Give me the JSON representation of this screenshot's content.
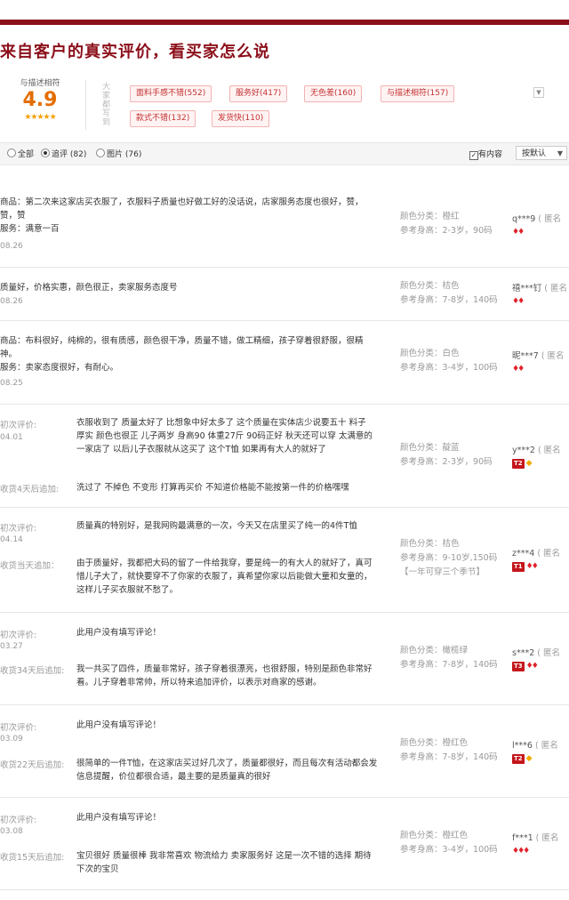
{
  "heading": "来自客户的真实评价，看买家怎么说",
  "score": {
    "label": "与描述相符",
    "value": "4.9",
    "stars": "★★★★★"
  },
  "tags_title": "大家都写到",
  "tags": [
    "面料手感不错(552)",
    "服务好(417)",
    "无色差(160)",
    "与描述相符(157)",
    "款式不错(132)",
    "发货快(110)"
  ],
  "filter": {
    "all": "全部",
    "append": "追评 (82)",
    "photo": "图片 (76)",
    "has_content": "有内容",
    "sort": "按默认"
  },
  "labels": {
    "color": "颜色分类：",
    "height": "参考身高：",
    "first": "初次评价:",
    "anon": "( 匿名"
  },
  "reviews": [
    {
      "text": "商品：第二次来这家店买衣服了，衣服料子质量也好做工好的没话说，店家服务态度也很好，赞，赞，赞\n服务：满意一百",
      "date": "08.26",
      "color": "橙红",
      "height": "2-3岁，90码",
      "user": "q***9",
      "badge": "hearts2"
    },
    {
      "text": "质量好，价格实惠，颜色很正，卖家服务态度号",
      "date": "08.26",
      "color": "桔色",
      "height": "7-8岁，140码",
      "user": "禧***钉",
      "badge": "hearts2"
    },
    {
      "text": "商品：布料很好，纯棉的，很有质感，颜色很干净，质量不错，做工精细，孩子穿着很舒服，很精神。\n服务：卖家态度很好，有耐心。",
      "date": "08.25",
      "color": "白色",
      "height": "3-4岁，100码",
      "user": "昵***7",
      "badge": "hearts2"
    },
    {
      "first_text": "衣服收到了 质量太好了 比想象中好太多了 这个质量在实体店少说要五十 料子厚实 颜色也很正 儿子两岁 身高90 体重27斤 90码正好 秋天还可以穿 太满意的一家店了 以后儿子衣服就从这买了 这个T恤 如果再有大人的就好了",
      "date": "04.01",
      "append_label": "收货4天后追加:",
      "append_text": "洗过了 不掉色 不变形 打算再买价 不知道价格能不能按第一件的价格嘿嘿",
      "color": "靛蓝",
      "height": "2-3岁，90码",
      "user": "y***2",
      "badge": "T2"
    },
    {
      "first_text": "质量真的特别好，是我网购最满意的一次，今天又在店里买了纯一的4件T恤",
      "date": "04.14",
      "append_label": "收货当天追加：",
      "append_text": "由于质量好，我都把大码的留了一件给我穿，要是纯一的有大人的就好了，真可惜儿子大了，就快要穿不了你家的衣服了，真希望你家以后能做大童和女童的，这样儿子买衣服就不愁了。",
      "color": "桔色",
      "height": "9-10岁,150码",
      "height_note": "【一年可穿三个季节】",
      "user": "z***4",
      "badge": "T1"
    },
    {
      "first_text": "此用户没有填写评论！",
      "date": "03.27",
      "append_label": "收货34天后追加:",
      "append_text": "我一共买了四件，质量非常好，孩子穿着很漂亮，也很舒服，特别是颜色非常好看。儿子穿着非常帅，所以特来追加评价，以表示对商家的感谢。",
      "color": "橄榄绿",
      "height": "7-8岁，140码",
      "user": "s***2",
      "badge": "T3"
    },
    {
      "first_text": "此用户没有填写评论！",
      "date": "03.09",
      "append_label": "收货22天后追加:",
      "append_text": "很简单的一件T恤，在这家店买过好几次了，质量都很好，而且每次有活动都会发信息提醒，价位都很合适，最主要的是质量真的很好",
      "color": "橙红色",
      "height": "7-8岁，140码",
      "user": "l***6",
      "badge": "T2"
    },
    {
      "first_text": "此用户没有填写评论！",
      "date": "03.08",
      "append_label": "收货15天后追加:",
      "append_text": "宝贝很好 质量很棒 我非常喜欢 物流给力 卖家服务好 这是一次不错的选择 期待下次的宝贝",
      "color": "橙红色",
      "height": "3-4岁，100码",
      "user": "f***1",
      "badge": "hearts3"
    }
  ]
}
